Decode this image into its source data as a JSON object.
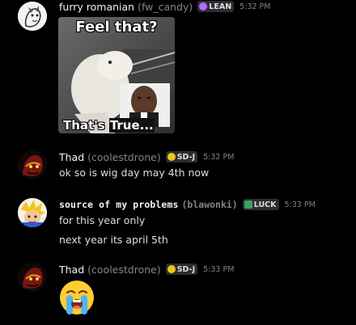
{
  "messages": [
    {
      "author": "furry romanian",
      "handle": "(fw_candy)",
      "tag": "LEAN",
      "tag_color": "#b36bff",
      "time": "5:32 PM",
      "image": {
        "top_caption": "Feel that?",
        "bottom_caption_1": "That's",
        "bottom_caption_2": "True..."
      }
    },
    {
      "author": "Thad",
      "handle": "(coolestdrone)",
      "tag": "SD-J",
      "tag_color": "#f0c419",
      "time": "5:32 PM",
      "lines": [
        "ok so is wig day may 4th now"
      ]
    },
    {
      "author": "source of my problems",
      "handle": "(blawonki)",
      "tag": "LUCK",
      "tag_color": "#3ba55d",
      "time": "5:33 PM",
      "lines": [
        "for this year only",
        "next year its april 5th"
      ]
    },
    {
      "author": "Thad",
      "handle": "(coolestdrone)",
      "tag": "SD-J",
      "tag_color": "#f0c419",
      "time": "5:33 PM",
      "emoji": "loudly-crying-face"
    }
  ]
}
